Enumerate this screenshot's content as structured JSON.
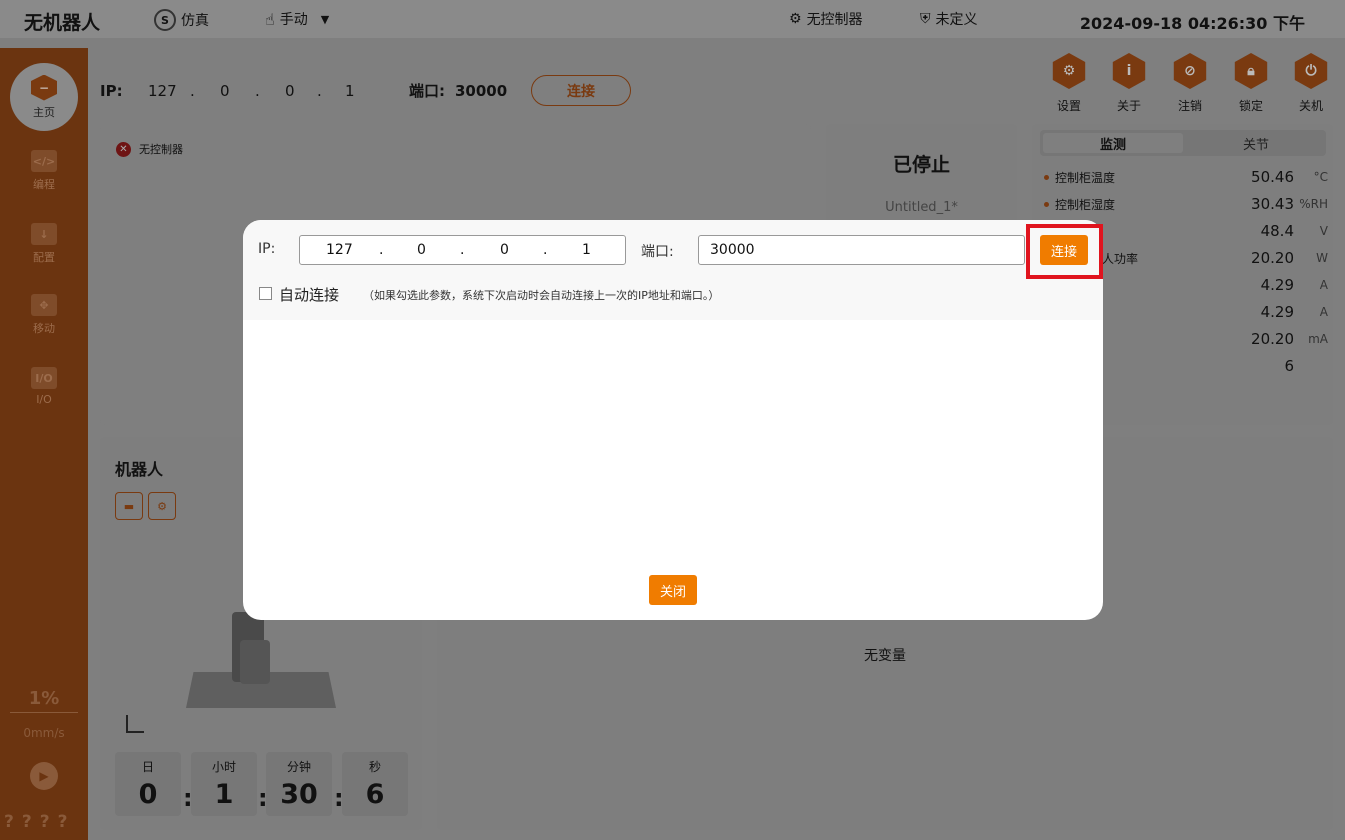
{
  "topbar": {
    "app_title": "无机器人",
    "sim_label": "仿真",
    "manual_label": "手动",
    "controller_label": "无控制器",
    "undefined_label": "未定义",
    "datetime": "2024-09-18 04:26:30 下午"
  },
  "sidebar": {
    "home": "主页",
    "items": [
      {
        "icon": "</>",
        "label": "编程"
      },
      {
        "icon": "↓",
        "label": "配置"
      },
      {
        "icon": "✥",
        "label": "移动"
      },
      {
        "icon": "I/O",
        "label": "I/O"
      }
    ],
    "speed_percent": "1%",
    "speed_value": "0mm/s",
    "bottom_marks": "????"
  },
  "connection_bar": {
    "ip_label": "IP:",
    "ip": [
      "127",
      "0",
      "0",
      "1"
    ],
    "dot": ".",
    "port_label": "端口:",
    "port": "30000",
    "connect": "连接"
  },
  "toolbar": {
    "settings": "设置",
    "about": "关于",
    "logout": "注销",
    "lock": "锁定",
    "shutdown": "关机"
  },
  "status_panel": {
    "controller_status": "无控制器"
  },
  "program_panel": {
    "state": "已停止",
    "program_name": "Untitled_1*"
  },
  "monitor": {
    "tabs": [
      "监测",
      "关节"
    ],
    "rows": [
      {
        "name": "控制柜温度",
        "value": "50.46",
        "unit": "°C",
        "dot": true
      },
      {
        "name": "控制柜湿度",
        "value": "30.43",
        "unit": "%RH",
        "dot": true
      },
      {
        "name": "",
        "value": "48.4",
        "unit": "V",
        "dot": false
      },
      {
        "name": "人功率",
        "value": "20.20",
        "unit": "W",
        "dot": false
      },
      {
        "name": "",
        "value": "4.29",
        "unit": "A",
        "dot": false
      },
      {
        "name": "",
        "value": "4.29",
        "unit": "A",
        "dot": false
      },
      {
        "name": "",
        "value": "20.20",
        "unit": "mA",
        "dot": false
      },
      {
        "name": "",
        "value": "6",
        "unit": "",
        "dot": false
      }
    ]
  },
  "robot_panel": {
    "title": "机器人"
  },
  "runtime": {
    "labels": [
      "日",
      "小时",
      "分钟",
      "秒"
    ],
    "values": [
      "0",
      "1",
      "30",
      "6"
    ],
    "colon": ":"
  },
  "variables_panel": {
    "empty_text": "无变量"
  },
  "modal": {
    "ip_label": "IP:",
    "ip": [
      "127",
      "0",
      "0",
      "1"
    ],
    "dot": ".",
    "port_label": "端口:",
    "port_value": "30000",
    "connect": "连接",
    "auto_connect_label": "自动连接",
    "auto_connect_hint": "（如果勾选此参数，系统下次启动时会自动连接上一次的IP地址和端口。）",
    "close": "关闭"
  },
  "colors": {
    "accent": "#f07c00",
    "highlight": "#e0141e"
  }
}
